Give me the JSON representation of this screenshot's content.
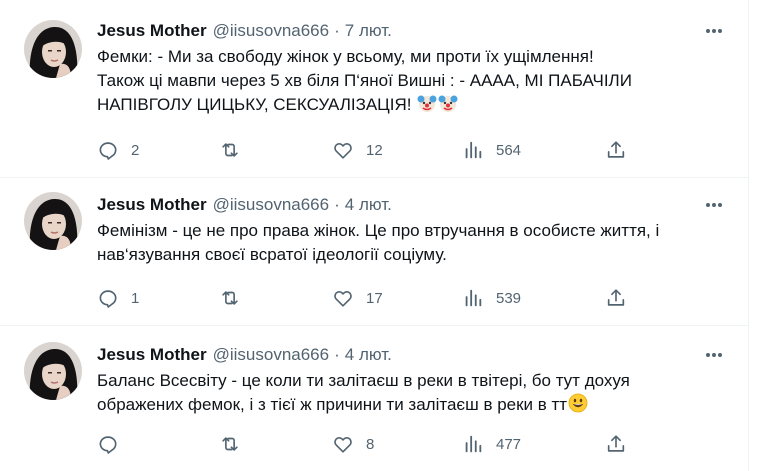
{
  "tweets": [
    {
      "name": "Jesus Mother",
      "handle": "@iisusovna666",
      "separator": "·",
      "date": "7 лют.",
      "lines": [
        "Фемки:  - Ми за свободу жінок у всьому, ми проти їх ущімлення!",
        "Також ці мавпи через 5 хв біля П‘яної Вишні : - АААА, МІ ПАБАЧІЛИ",
        "НАПІВГОЛУ ЦИЦЬКУ, СЕКСУАЛІЗАЦІЯ!"
      ],
      "trailing_emoji": [
        "clown-face",
        "clown-face"
      ],
      "replies": "2",
      "retweets": "",
      "likes": "12",
      "views": "564"
    },
    {
      "name": "Jesus Mother",
      "handle": "@iisusovna666",
      "separator": "·",
      "date": "4 лют.",
      "lines": [
        "Фемінізм - це не про права жінок. Це про втручання в особисте життя, і",
        "нав‘язування своєї всратої ідеології соціуму."
      ],
      "trailing_emoji": [],
      "replies": "1",
      "retweets": "",
      "likes": "17",
      "views": "539"
    },
    {
      "name": "Jesus Mother",
      "handle": "@iisusovna666",
      "separator": "·",
      "date": "4 лют.",
      "lines": [
        "Баланс Всесвіту - це коли ти залітаєш в реки в твітері, бо тут дохуя",
        "ображених фемок, і з тієї ж причини ти залітаєш в реки в тт"
      ],
      "trailing_emoji": [
        "grinning-face"
      ],
      "replies": "",
      "retweets": "",
      "likes": "8",
      "views": "477"
    }
  ],
  "icons": {
    "reply": "reply-icon",
    "retweet": "retweet-icon",
    "like": "heart-icon",
    "views": "views-bar-chart-icon",
    "share": "share-icon",
    "more": "more-options-icon"
  },
  "colors": {
    "text_primary": "#0f1419",
    "text_secondary": "#536471",
    "divider": "#eff3f4",
    "background": "#ffffff"
  }
}
